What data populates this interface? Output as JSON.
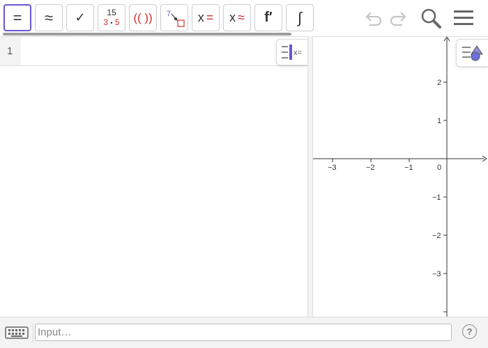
{
  "toolbar": {
    "symbolic_label": "=",
    "numeric_label": "≈",
    "check_label": "✓",
    "factor_top": "15",
    "factor_bottom_left": "3",
    "factor_dot": "•",
    "factor_bottom_right": "5",
    "expand_label": "(( ))",
    "subst_num": "7",
    "solve_x": "x",
    "solve_eq": "=",
    "nsolve_x": "x",
    "nsolve_eq": "≈",
    "derivative_label": "f′",
    "integral_label": "∫"
  },
  "algebra": {
    "row_number": "1",
    "style_tab_text": "x="
  },
  "graphics": {
    "x_ticks": [
      "−3",
      "−2",
      "−1",
      "0"
    ],
    "y_ticks": [
      "2",
      "1",
      "−1",
      "−2",
      "−3"
    ]
  },
  "input_bar": {
    "placeholder": "Input…",
    "help_label": "?"
  },
  "colors": {
    "accent": "#6557d2",
    "red": "#d32f2f",
    "panel_bg": "#f3f3f3"
  }
}
